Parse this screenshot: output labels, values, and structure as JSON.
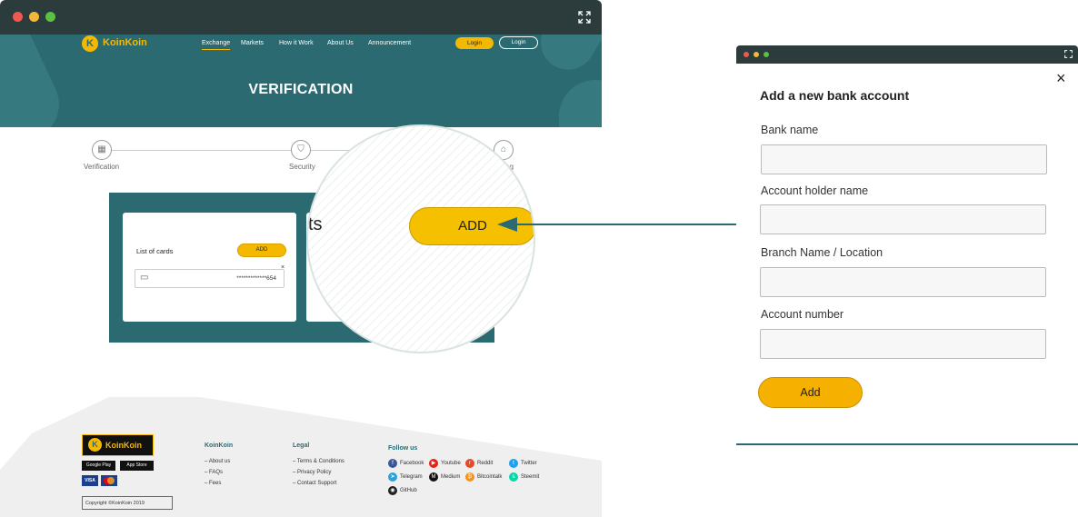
{
  "left_window": {
    "brand": "KoinKoin",
    "nav": [
      "Exchange",
      "Markets",
      "How it Work",
      "About Us",
      "Announcement"
    ],
    "login_primary": "Login",
    "login_secondary": "Login",
    "hero_title": "VERIFICATION",
    "steps": [
      "Verification",
      "Security",
      "ng"
    ],
    "cards_title": "List of cards",
    "add_small": "ADD",
    "card_number": "*************654",
    "card_remove": "×",
    "partial_heading": "ts",
    "add_big": "ADD",
    "footer": {
      "brand": "KoinKoin",
      "store_google": "Google Play",
      "store_apple": "App Store",
      "pay_visa": "VISA",
      "copyright": "Copyright ©KoinKoin 2019",
      "col1_title": "KoinKoin",
      "col1_items": [
        "About us",
        "FAQs",
        "Fees"
      ],
      "col2_title": "Legal",
      "col2_items": [
        "Terms & Conditions",
        "Privacy Policy",
        "Contact Support"
      ],
      "follow_title": "Follow us",
      "socials": [
        "Facebook",
        "Youtube",
        "Reddit",
        "Twitter",
        "Telegram",
        "Medium",
        "Bitcointalk",
        "Steemit",
        "GitHub"
      ]
    }
  },
  "modal": {
    "title": "Add a new bank account",
    "close": "×",
    "fields": [
      {
        "label": "Bank name",
        "value": ""
      },
      {
        "label": "Account holder name",
        "value": ""
      },
      {
        "label": "Branch Name / Location",
        "value": ""
      },
      {
        "label": "Account number",
        "value": ""
      }
    ],
    "submit": "Add"
  },
  "colors": {
    "teal": "#2b6a70",
    "yellow": "#f5b800",
    "chrome": "#2c3b3c"
  }
}
